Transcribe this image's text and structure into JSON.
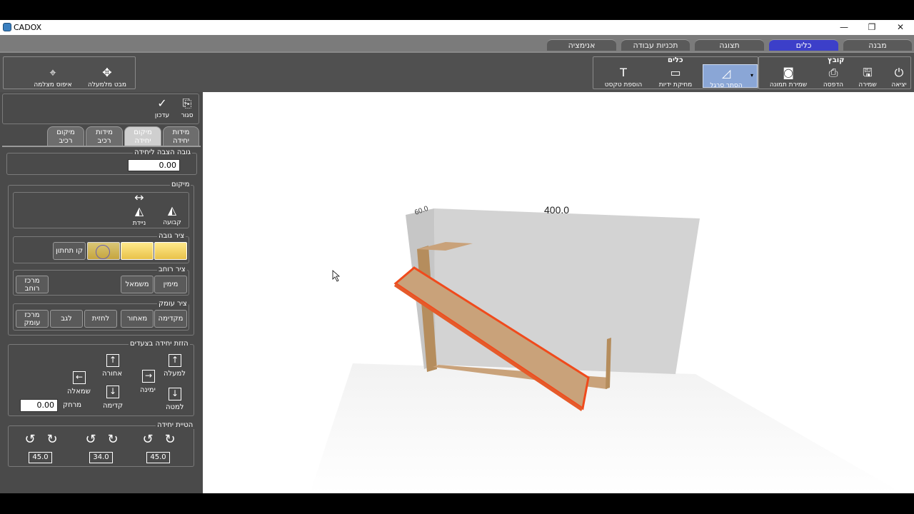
{
  "window": {
    "title": "CADOX",
    "min": "—",
    "restore": "❐",
    "close": "✕"
  },
  "tabs": [
    "מבנה",
    "כלים",
    "תצוגה",
    "תכניות עבודה",
    "אנימציה"
  ],
  "ribbon": {
    "group_file": "קובץ",
    "group_tools": "כלים",
    "exit": "יציאה",
    "save": "שמירה",
    "print": "הדפסה",
    "save_image": "שמירת תמונה",
    "ruler": "הסתר סרגל",
    "erase_dims": "מחיקת ידיות",
    "add_text": "הוספת טקסט",
    "camera_view": "מבט מלמעלה",
    "camera_reset": "איפוס מצלמה"
  },
  "left": {
    "close": "סגור",
    "update": "עדכון",
    "tabs": [
      "מידות\nיחידה",
      "מיקום\nיחידה",
      "מידות\nרכיב",
      "מיקום\nרכיב"
    ],
    "height_section": "גובה הצבה ליחידה",
    "height_value": "0.00",
    "position_section": "מיקום",
    "fixed": "קבועה",
    "moving": "ניידת",
    "height_axis": "ציר גובה",
    "bottom_line": "קו תחתון",
    "width_axis": "ציר רוחב",
    "right": "מימין",
    "left": "משמאל",
    "center_width": "מרכז\nרוחב",
    "depth_axis": "ציר עומק",
    "front": "מקדימה",
    "back": "מאחור",
    "to_wall": "לחזית",
    "to_back": "לגב",
    "center_depth": "מרכז\nעומק",
    "move_section": "הזזת יחידה בצעדים",
    "up": "למעלה",
    "backward": "אחורה",
    "right_move": "ימינה",
    "left_move": "שמאלה",
    "down": "למטה",
    "forward": "קדימה",
    "distance": "מרחק",
    "distance_value": "0.00",
    "tilt_section": "הטיית יחידה",
    "tilt_values": [
      "45.0",
      "34.0",
      "45.0"
    ]
  },
  "viewport": {
    "dim_width": "400.0",
    "dim_depth": "60.0"
  }
}
